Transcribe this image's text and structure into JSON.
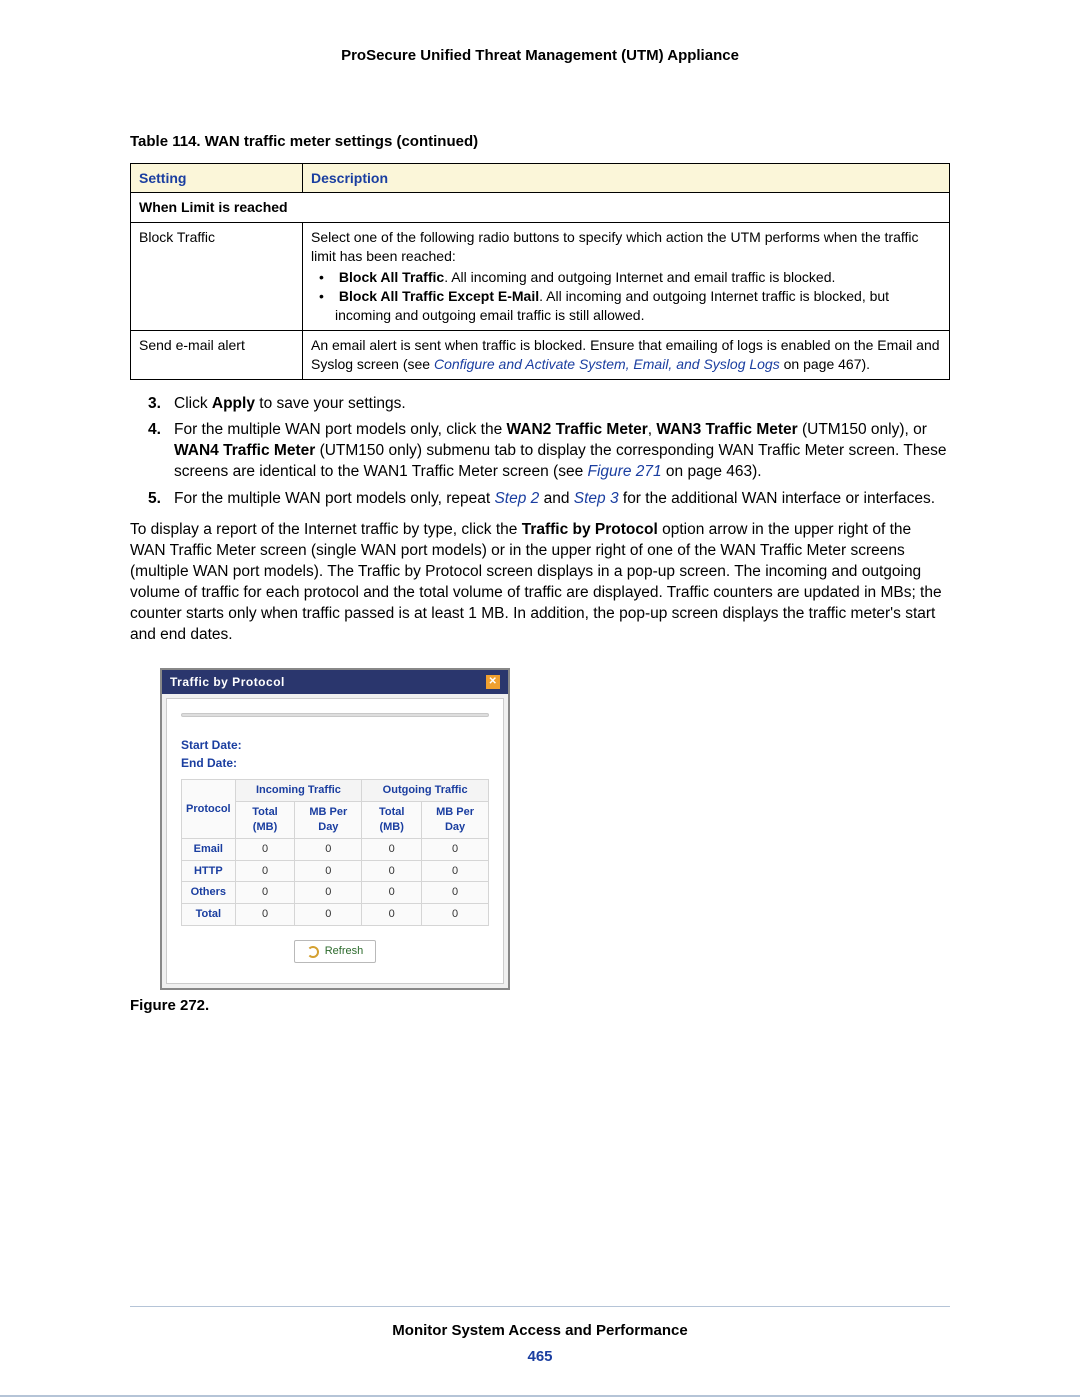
{
  "doc_title": "ProSecure Unified Threat Management (UTM) Appliance",
  "table": {
    "caption": "Table 114.  WAN traffic meter settings (continued)",
    "headers": {
      "setting": "Setting",
      "description": "Description"
    },
    "section": "When Limit is reached",
    "rows": [
      {
        "setting": "Block Traffic",
        "intro": "Select one of the following radio buttons to specify which action the UTM performs when the traffic limit has been reached:",
        "bullets": [
          {
            "term": "Block All Traffic",
            "text": ". All incoming and outgoing Internet and email traffic is blocked."
          },
          {
            "term": "Block All Traffic Except E-Mail",
            "text": ". All incoming and outgoing Internet traffic is blocked, but incoming and outgoing email traffic is still allowed."
          }
        ]
      },
      {
        "setting": "Send e-mail alert",
        "text_before": "An email alert is sent when traffic is blocked. Ensure that emailing of logs is enabled on the Email and Syslog screen (see ",
        "link": "Configure and Activate System, Email, and Syslog Logs",
        "text_after": " on page 467)."
      }
    ]
  },
  "steps": {
    "s3_click": "Click ",
    "s3_apply": "Apply",
    "s3_rest": " to save your settings.",
    "s4_a": "For the multiple WAN port models only, click the ",
    "s4_b1": "WAN2 Traffic Meter",
    "s4_sep1": ", ",
    "s4_b2": "WAN3 Traffic Meter",
    "s4_paren1": " (UTM150 only), or ",
    "s4_b3": "WAN4 Traffic Meter",
    "s4_rest": " (UTM150 only) submenu tab to display the corresponding WAN Traffic Meter screen. These screens are identical to the WAN1 Traffic Meter screen (see ",
    "s4_link": "Figure 271",
    "s4_end": " on page 463).",
    "s5_a": "For the multiple WAN port models only, repeat ",
    "s5_l1": "Step 2",
    "s5_and": " and ",
    "s5_l2": "Step 3",
    "s5_rest": " for the additional WAN interface or interfaces."
  },
  "para": {
    "t1": "To display a report of the Internet traffic by type, click the ",
    "bold": "Traffic by Protocol",
    "t2": " option arrow in the upper right of the WAN Traffic Meter screen (single WAN port models) or in the upper right of one of the WAN Traffic Meter screens (multiple WAN port models). The Traffic by Protocol screen displays in a pop-up screen. The incoming and outgoing volume of traffic for each protocol and the total volume of traffic are displayed. Traffic counters are updated in MBs; the counter starts only when traffic passed is at least 1 MB. In addition, the pop-up screen displays the traffic meter's start and end dates."
  },
  "popup": {
    "title": "Traffic by Protocol",
    "start_date_label": "Start Date:",
    "end_date_label": "End Date:",
    "protocol_label": "Protocol",
    "incoming_label": "Incoming Traffic",
    "outgoing_label": "Outgoing Traffic",
    "sub_headers": [
      "Total (MB)",
      "MB Per Day",
      "Total (MB)",
      "MB Per Day"
    ],
    "refresh_label": "Refresh"
  },
  "chart_data": {
    "type": "table",
    "title": "Traffic by Protocol",
    "columns": [
      "Protocol",
      "Incoming Total (MB)",
      "Incoming MB Per Day",
      "Outgoing Total (MB)",
      "Outgoing MB Per Day"
    ],
    "rows": [
      {
        "protocol": "Email",
        "in_total": 0,
        "in_per_day": 0,
        "out_total": 0,
        "out_per_day": 0
      },
      {
        "protocol": "HTTP",
        "in_total": 0,
        "in_per_day": 0,
        "out_total": 0,
        "out_per_day": 0
      },
      {
        "protocol": "Others",
        "in_total": 0,
        "in_per_day": 0,
        "out_total": 0,
        "out_per_day": 0
      },
      {
        "protocol": "Total",
        "in_total": 0,
        "in_per_day": 0,
        "out_total": 0,
        "out_per_day": 0
      }
    ]
  },
  "figure_caption": "Figure 272.",
  "footer": {
    "title": "Monitor System Access and Performance",
    "page": "465"
  }
}
